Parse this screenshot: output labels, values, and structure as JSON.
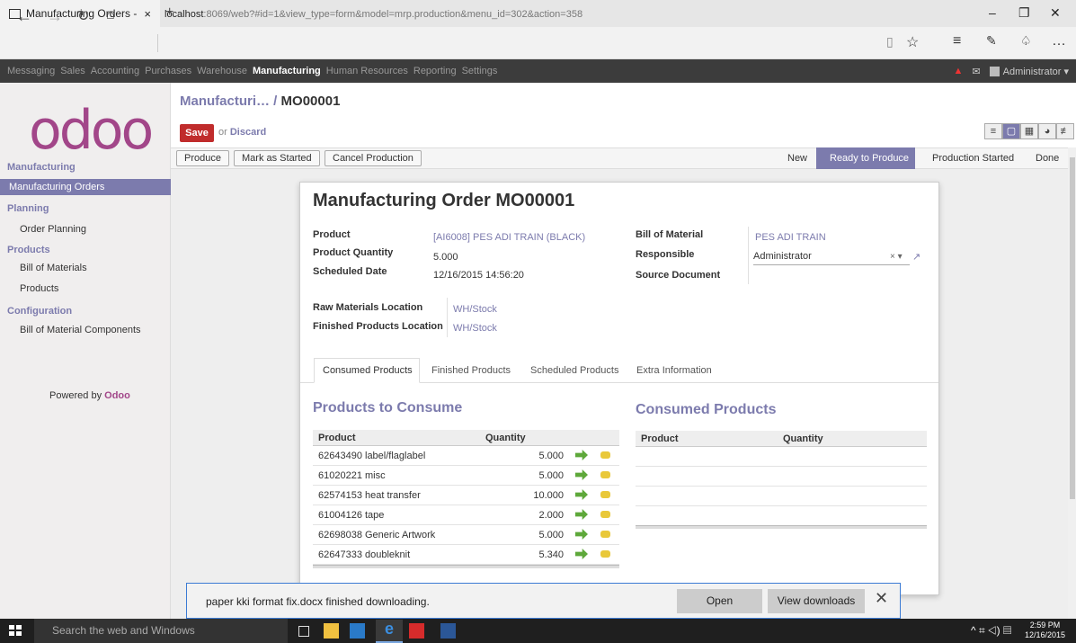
{
  "browser": {
    "tab_title": "Manufacturing Orders -",
    "tab_close": "×",
    "new_tab": "+",
    "url_host": "localhost",
    "url_rest": ":8069/web?#id=1&view_type=form&model=mrp.production&menu_id=302&action=358",
    "win_min": "–",
    "win_max": "❐",
    "win_close": "✕"
  },
  "topbar": {
    "menus": [
      "Messaging",
      "Sales",
      "Accounting",
      "Purchases",
      "Warehouse",
      "Manufacturing",
      "Human Resources",
      "Reporting",
      "Settings"
    ],
    "active": "Manufacturing",
    "user": "Administrator ▾"
  },
  "sidebar": {
    "logo": "odoo",
    "sections": [
      {
        "title": "Manufacturing",
        "items": [
          "Manufacturing Orders"
        ]
      },
      {
        "title": "Planning",
        "items": [
          "Order Planning"
        ]
      },
      {
        "title": "Products",
        "items": [
          "Bill of Materials",
          "Products"
        ]
      },
      {
        "title": "Configuration",
        "items": [
          "Bill of Material Components"
        ]
      }
    ],
    "powered_by": "Powered by",
    "powered_brand": "Odoo"
  },
  "header": {
    "breadcrumb_parent": "Manufacturi…",
    "breadcrumb_sep": " / ",
    "breadcrumb_current": "MO00001",
    "save_label": "Save",
    "or_text": "or",
    "discard_label": "Discard"
  },
  "statusbar": {
    "buttons": [
      "Produce",
      "Mark as Started",
      "Cancel Production"
    ],
    "stages": [
      "New",
      "Ready to Produce",
      "Production Started",
      "Done"
    ],
    "active_stage": "Ready to Produce"
  },
  "form": {
    "title_prefix": "Manufacturing Order",
    "title_ref": "MO00001",
    "fields_left": [
      {
        "label": "Product",
        "value": "[AI6008] PES ADI TRAIN (BLACK)",
        "link": true
      },
      {
        "label": "Product Quantity",
        "value": "5.000",
        "link": false
      },
      {
        "label": "Scheduled Date",
        "value": "12/16/2015 14:56:20",
        "link": false
      }
    ],
    "fields_right": [
      {
        "label": "Bill of Material",
        "value": "PES ADI TRAIN",
        "link": true
      },
      {
        "label": "Responsible",
        "value": "Administrator",
        "link": false
      },
      {
        "label": "Source Document",
        "value": "",
        "link": false
      }
    ],
    "locations": [
      {
        "label": "Raw Materials Location",
        "value": "WH/Stock"
      },
      {
        "label": "Finished Products Location",
        "value": "WH/Stock"
      }
    ],
    "tabs": [
      "Consumed Products",
      "Finished Products",
      "Scheduled Products",
      "Extra Information"
    ],
    "active_tab": "Consumed Products",
    "to_consume_title": "Products to Consume",
    "consumed_title": "Consumed Products",
    "col_product": "Product",
    "col_quantity": "Quantity",
    "to_consume": [
      {
        "product": "62643490 label/flaglabel",
        "qty": "5.000"
      },
      {
        "product": "61020221 misc",
        "qty": "5.000"
      },
      {
        "product": "62574153 heat transfer",
        "qty": "10.000"
      },
      {
        "product": "61004126 tape",
        "qty": "2.000"
      },
      {
        "product": "62698038 Generic Artwork",
        "qty": "5.000"
      },
      {
        "product": "62647333 doubleknit",
        "qty": "5.340"
      }
    ]
  },
  "download": {
    "message": "paper kki format fix.docx finished downloading.",
    "open": "Open",
    "view": "View downloads",
    "close": "✕"
  },
  "taskbar": {
    "search": "Search the web and Windows",
    "time": "2:59 PM",
    "date": "12/16/2015"
  }
}
